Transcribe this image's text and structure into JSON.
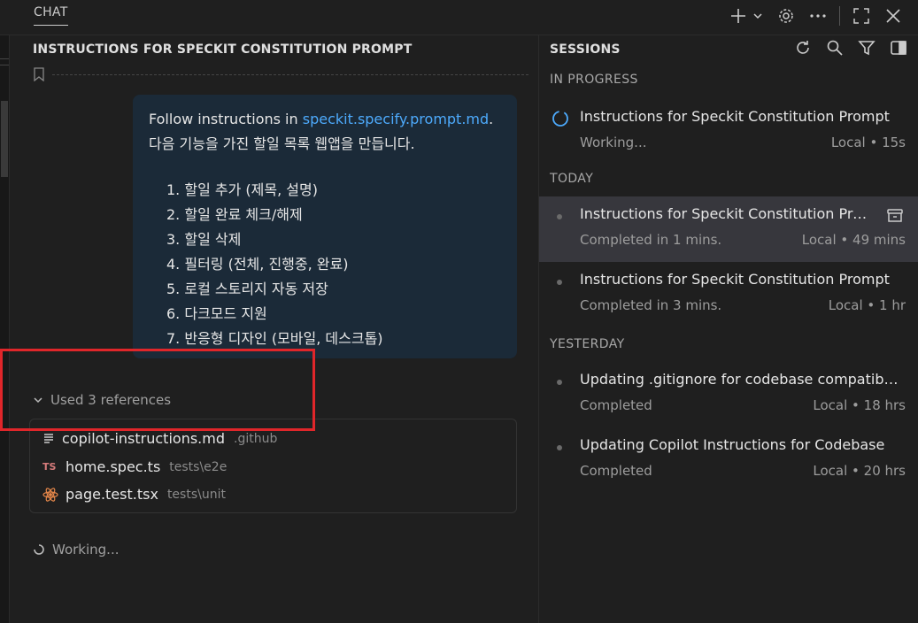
{
  "topbar": {
    "tab": "CHAT",
    "icons": [
      "plus-icon",
      "chevron-down-icon",
      "gear-icon",
      "ellipsis-icon",
      "maximize-icon",
      "close-icon"
    ]
  },
  "chat": {
    "title": "INSTRUCTIONS FOR SPECKIT CONSTITUTION PROMPT",
    "message": {
      "prefix": "Follow instructions in ",
      "link": "speckit.specify.prompt.md",
      "suffix": ".",
      "line2": "다음 기능을 가진 할일 목록 웹앱을 만듭니다.",
      "items": [
        "1. 할일 추가 (제목, 설명)",
        "2. 할일 완료 체크/해제",
        "3. 할일 삭제",
        "4. 필터링 (전체, 진행중, 완료)",
        "5. 로컬 스토리지 자동 저장",
        "6. 다크모드 지원",
        "7. 반응형 디자인 (모바일, 데스크톱)"
      ]
    },
    "references": {
      "header": "Used 3 references",
      "items": [
        {
          "name": "copilot-instructions.md",
          "path": ".github"
        },
        {
          "name": "home.spec.ts",
          "path": "tests\\e2e",
          "badge": "TS"
        },
        {
          "name": "page.test.tsx",
          "path": "tests\\unit"
        }
      ]
    },
    "status": "Working..."
  },
  "sessions": {
    "title": "SESSIONS",
    "sections": [
      {
        "label": "IN PROGRESS",
        "items": [
          {
            "title": "Instructions for Speckit Constitution Prompt",
            "status": "Working...",
            "meta": "Local • 15s"
          }
        ]
      },
      {
        "label": "TODAY",
        "items": [
          {
            "title": "Instructions for Speckit Constitution Prompt",
            "status": "Completed in 1 mins.",
            "meta": "Local • 49 mins"
          },
          {
            "title": "Instructions for Speckit Constitution Prompt",
            "status": "Completed in 3 mins.",
            "meta": "Local • 1 hr"
          }
        ]
      },
      {
        "label": "YESTERDAY",
        "items": [
          {
            "title": "Updating .gitignore for codebase compatibility",
            "status": "Completed",
            "meta": "Local • 18 hrs"
          },
          {
            "title": "Updating Copilot Instructions for Codebase",
            "status": "Completed",
            "meta": "Local • 20 hrs"
          }
        ]
      }
    ]
  },
  "colors": {
    "accent": "#4daafc",
    "highlight": "#e0262a",
    "bubble": "#1b2a38"
  }
}
